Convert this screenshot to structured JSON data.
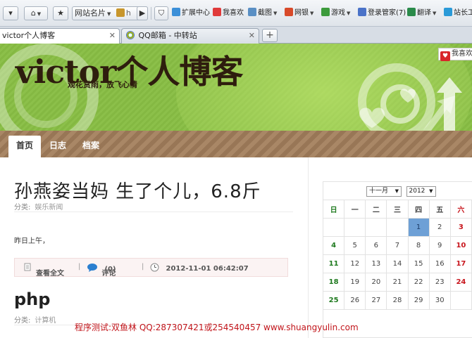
{
  "browser": {
    "toolbar": {
      "site_menu": "网站名片",
      "extensions": "扩展中心",
      "like": "我喜欢",
      "screenshot": "截图",
      "netbank": "网银",
      "games": "游戏",
      "login_manager": "登录管家(7)",
      "translate": "翻译",
      "webmaster": "站长工"
    },
    "tabs": [
      {
        "label": "victor个人博客",
        "active": true
      },
      {
        "label": "QQ邮箱 - 中转站",
        "active": false
      }
    ]
  },
  "blog": {
    "title": "victor个人博客",
    "subtitle": "观花赏雨，放飞心情",
    "like_label": "我喜欢",
    "nav": [
      "首页",
      "日志",
      "档案"
    ]
  },
  "posts": [
    {
      "title": "孙燕姿当妈  生了个儿，6.8斤",
      "category_label": "分类:",
      "category": "娱乐新闻",
      "excerpt": "昨日上午，",
      "read_more": "查看全文",
      "comments": "评论",
      "comment_count": "(0)",
      "datetime": "2012-11-01 06:42:07"
    },
    {
      "title": "php",
      "category_label": "分类:",
      "category": "计算机"
    }
  ],
  "calendar": {
    "month": "十一月",
    "year": "2012",
    "weekdays": [
      "日",
      "一",
      "二",
      "三",
      "四",
      "五",
      "六"
    ],
    "weeks": [
      [
        "",
        "",
        "",
        "",
        "1",
        "2",
        "3"
      ],
      [
        "4",
        "5",
        "6",
        "7",
        "8",
        "9",
        "10"
      ],
      [
        "11",
        "12",
        "13",
        "14",
        "15",
        "16",
        "17"
      ],
      [
        "18",
        "19",
        "20",
        "21",
        "22",
        "23",
        "24"
      ],
      [
        "25",
        "26",
        "27",
        "28",
        "29",
        "30",
        ""
      ]
    ],
    "today": "1"
  },
  "watermark": "程序测试:双鱼林 QQ:287307421或254540457  www.shuangyulin.com"
}
